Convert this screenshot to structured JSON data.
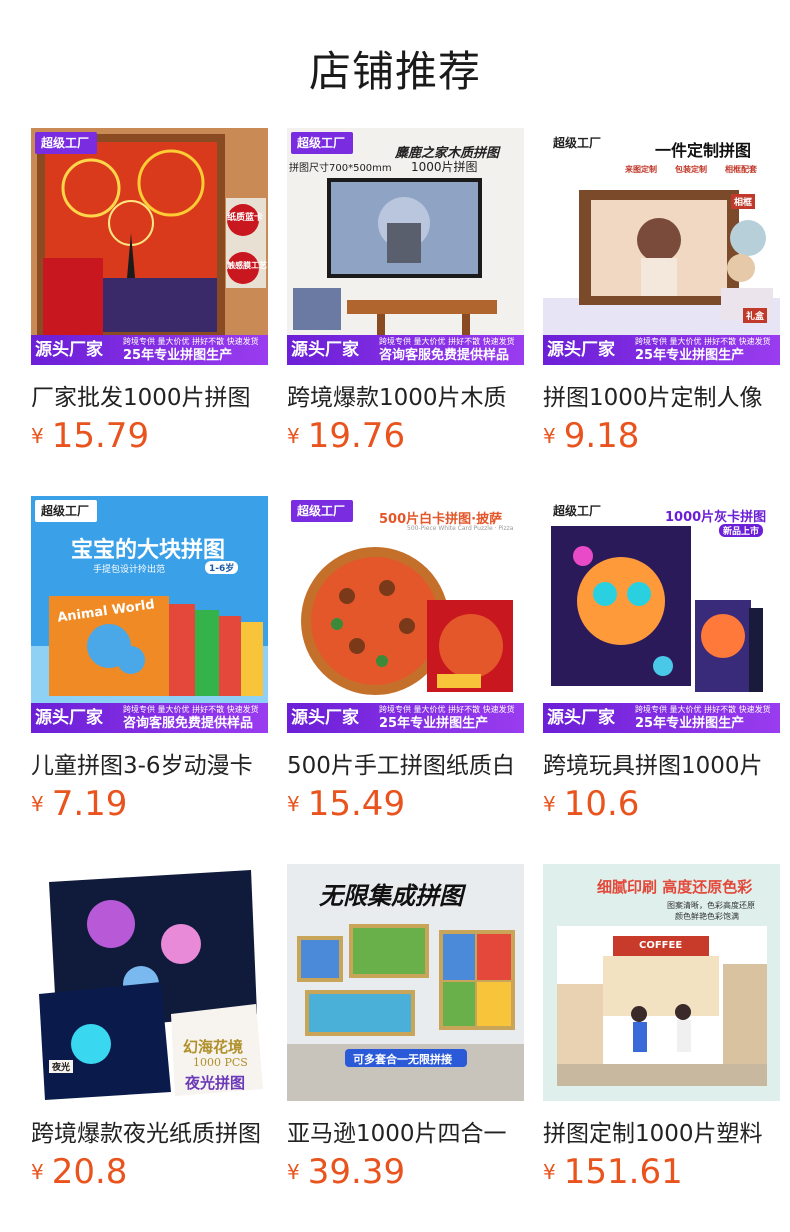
{
  "page": {
    "title": "店铺推荐"
  },
  "common": {
    "badge": "超级工厂",
    "source": "源头厂家",
    "tags": "跨境专供 量大价优 拼好不散 快速发货",
    "slogan_years": "25年专业拼图生产",
    "slogan_service": "咨询客服免费提供样品",
    "currency": "¥"
  },
  "products": [
    {
      "name": "厂家批发1000片拼图",
      "price": "15.79",
      "overlay": [
        "纸质蓝卡",
        "触感膜工艺"
      ]
    },
    {
      "name": "跨境爆款1000片木质",
      "price": "19.76",
      "overlay": [
        "麋鹿之家木质拼图",
        "拼图尺寸700*500mm",
        "1000片拼图"
      ]
    },
    {
      "name": "拼图1000片定制人像",
      "price": "9.18",
      "overlay": [
        "一件定制拼图",
        "来图定制",
        "包装定制",
        "相框配套",
        "相框",
        "礼盒"
      ]
    },
    {
      "name": "儿童拼图3-6岁动漫卡",
      "price": "7.19",
      "overlay": [
        "宝宝的大块拼图",
        "手提包设计拎出范",
        "1-6岁",
        "Animal World"
      ]
    },
    {
      "name": "500片手工拼图纸质白",
      "price": "15.49",
      "overlay": [
        "500片白卡拼图·披萨",
        "500-Piece White Card Puzzle · Pizza"
      ]
    },
    {
      "name": "跨境玩具拼图1000片",
      "price": "10.6",
      "overlay": [
        "1000片灰卡拼图",
        "新品上市"
      ]
    },
    {
      "name": "跨境爆款夜光纸质拼图",
      "price": "20.8",
      "overlay": [
        "幻海花境",
        "1000 PCS",
        "夜光拼图",
        "夜光"
      ]
    },
    {
      "name": "亚马逊1000片四合一",
      "price": "39.39",
      "overlay": [
        "无限集成拼图",
        "可多套合一无限拼接"
      ]
    },
    {
      "name": "拼图定制1000片塑料",
      "price": "151.61",
      "overlay": [
        "细腻印刷 高度还原色彩",
        "图案清晰，色彩高度还原",
        "颜色鲜艳色彩饱满",
        "COFFEE"
      ]
    }
  ]
}
